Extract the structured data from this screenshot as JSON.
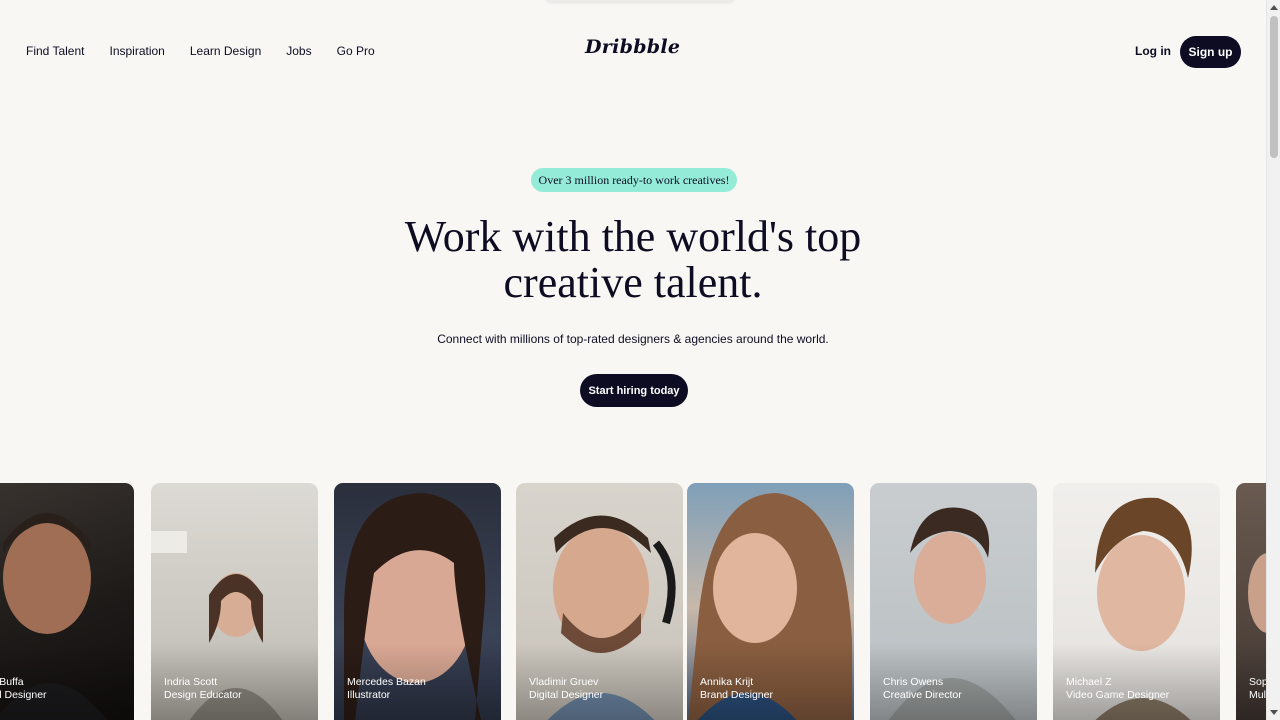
{
  "nav": {
    "links": [
      "Find Talent",
      "Inspiration",
      "Learn Design",
      "Jobs",
      "Go Pro"
    ],
    "logo": "Dribbble",
    "login_label": "Log in",
    "signup_label": "Sign up"
  },
  "hero": {
    "badge": "Over 3 million ready-to work creatives!",
    "headline_line1": "Work with the world's top",
    "headline_line2": "creative talent.",
    "subhead": "Connect with millions of top-rated designers & agencies around the world.",
    "cta_label": "Start hiring today"
  },
  "designers": [
    {
      "name": "iele Buffa",
      "role": "cipal Designer"
    },
    {
      "name": "Indria Scott",
      "role": "Design Educator"
    },
    {
      "name": "Mercedes Bazan",
      "role": "Illustrator"
    },
    {
      "name": "Vladimir Gruev",
      "role": "Digital Designer"
    },
    {
      "name": "Annika Krijt",
      "role": "Brand Designer"
    },
    {
      "name": "Chris Owens",
      "role": "Creative Director"
    },
    {
      "name": "Michael Z",
      "role": "Video Game Designer"
    },
    {
      "name": "Sop",
      "role": "Mult"
    }
  ],
  "colors": {
    "background": "#f8f7f4",
    "ink": "#0d0c22",
    "badge": "#94ecd8"
  }
}
